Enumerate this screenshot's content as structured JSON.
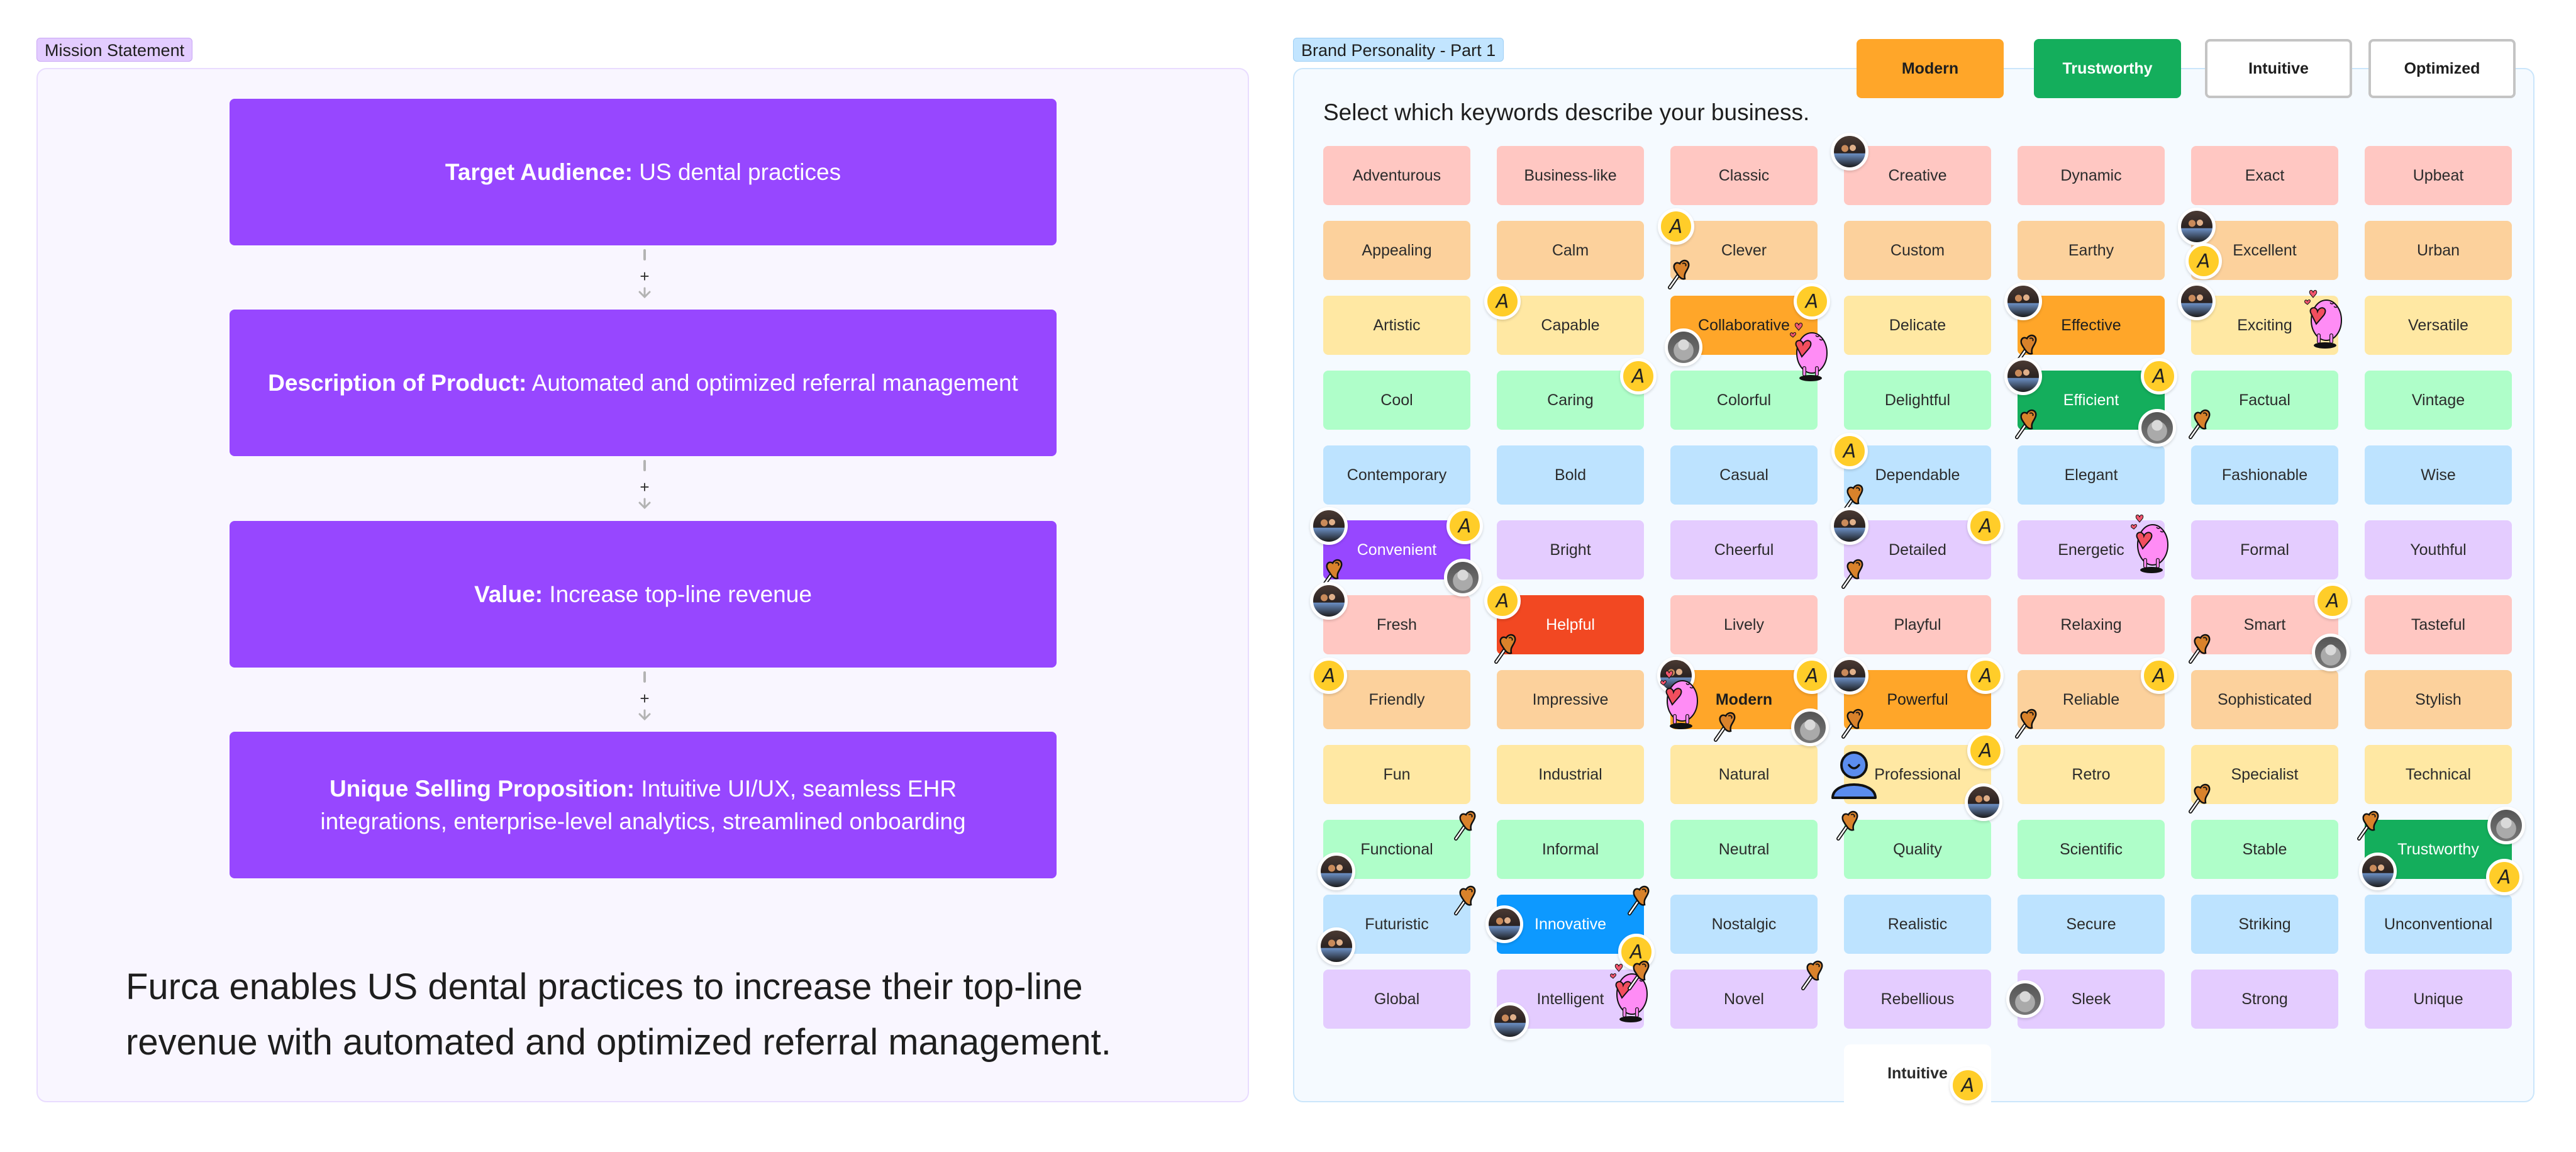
{
  "mission": {
    "label": "Mission Statement",
    "steps": [
      {
        "heading": "Target Audience:",
        "text": " US dental practices"
      },
      {
        "heading": "Description of Product:",
        "text": " Automated and optimized referral management"
      },
      {
        "heading": "Value:",
        "text": " Increase top-line revenue"
      },
      {
        "heading": "Unique Selling Proposition:",
        "text": " Intuitive UI/UX, seamless EHR integrations, enterprise-level analytics, streamlined onboarding"
      }
    ],
    "connector_symbol": "+",
    "statement": "Furca enables US dental practices to increase their top-line revenue with automated and optimized referral management."
  },
  "brand": {
    "label": "Brand Personality - Part 1",
    "prompt": "Select which keywords describe your business.",
    "chosen": [
      {
        "label": "Modern",
        "color": "#ffa629",
        "text_color": "#1e1e1e"
      },
      {
        "label": "Trustworthy",
        "color": "#14ae5c",
        "text_color": "#ffffff"
      },
      {
        "label": "Intuitive",
        "color": "#ffffff",
        "text_color": "#1e1e1e"
      },
      {
        "label": "Optimized",
        "color": "#ffffff",
        "text_color": "#1e1e1e"
      }
    ],
    "row_colors": [
      "#ffc7c2",
      "#fcd19c",
      "#ffe8a3",
      "#affec9",
      "#bde3ff",
      "#e4ccff"
    ],
    "rows": [
      [
        "Adventurous",
        "Business-like",
        "Classic",
        "Creative",
        "Dynamic",
        "Exact",
        "Upbeat"
      ],
      [
        "Appealing",
        "Calm",
        "Clever",
        "Custom",
        "Earthy",
        "Excellent",
        "Urban"
      ],
      [
        "Artistic",
        "Capable",
        "Collaborative",
        "Delicate",
        "Effective",
        "Exciting",
        "Versatile"
      ],
      [
        "Cool",
        "Caring",
        "Colorful",
        "Delightful",
        "Efficient",
        "Factual",
        "Vintage"
      ],
      [
        "Contemporary",
        "Bold",
        "Casual",
        "Dependable",
        "Elegant",
        "Fashionable",
        "Wise"
      ],
      [
        "Convenient",
        "Bright",
        "Cheerful",
        "Detailed",
        "Energetic",
        "Formal",
        "Youthful"
      ],
      [
        "Fresh",
        "Helpful",
        "Lively",
        "Playful",
        "Relaxing",
        "Smart",
        "Tasteful"
      ],
      [
        "Friendly",
        "Impressive",
        "Modern",
        "Powerful",
        "Reliable",
        "Sophisticated",
        "Stylish"
      ],
      [
        "Fun",
        "Industrial",
        "Natural",
        "Professional",
        "Retro",
        "Specialist",
        "Technical"
      ],
      [
        "Functional",
        "Informal",
        "Neutral",
        "Quality",
        "Scientific",
        "Stable",
        "Trustworthy"
      ],
      [
        "Futuristic",
        "Innovative",
        "Nostalgic",
        "Realistic",
        "Secure",
        "Striking",
        "Unconventional"
      ],
      [
        "Global",
        "Intelligent",
        "Novel",
        "Rebellious",
        "Sleek",
        "Strong",
        "Unique"
      ]
    ],
    "highlighted": {
      "Collaborative": "orange",
      "Effective": "orange",
      "Modern": "orange",
      "Powerful": "orange",
      "Efficient": "green",
      "Trustworthy": "green",
      "Convenient": "purple",
      "Helpful": "red",
      "Innovative": "blue"
    },
    "stickers": [
      {
        "type": "avatar-group",
        "tile": "Creative",
        "pos": "tl"
      },
      {
        "type": "badge-a",
        "tile": "Clever",
        "pos": "tl"
      },
      {
        "type": "pin",
        "tile": "Clever",
        "pos": "bl"
      },
      {
        "type": "badge-a",
        "tile": "Capable",
        "pos": "tl"
      },
      {
        "type": "badge-a",
        "tile": "Collaborative",
        "pos": "tr"
      },
      {
        "type": "monster",
        "tile": "Collaborative",
        "pos": "br"
      },
      {
        "type": "avatar-woman",
        "tile": "Collaborative",
        "pos": "bl"
      },
      {
        "type": "badge-a",
        "tile": "Caring",
        "pos": "tr"
      },
      {
        "type": "avatar-group",
        "tile": "Excellent",
        "pos": "tl"
      },
      {
        "type": "badge-a",
        "tile": "Excellent",
        "pos": "ml"
      },
      {
        "type": "avatar-group",
        "tile": "Effective",
        "pos": "tl"
      },
      {
        "type": "pin",
        "tile": "Effective",
        "pos": "bl"
      },
      {
        "type": "avatar-group",
        "tile": "Exciting",
        "pos": "tl"
      },
      {
        "type": "monster",
        "tile": "Exciting",
        "pos": "r"
      },
      {
        "type": "avatar-group",
        "tile": "Efficient",
        "pos": "tl"
      },
      {
        "type": "pin",
        "tile": "Efficient",
        "pos": "bl"
      },
      {
        "type": "badge-a",
        "tile": "Efficient",
        "pos": "tr"
      },
      {
        "type": "avatar-woman",
        "tile": "Efficient",
        "pos": "br"
      },
      {
        "type": "pin",
        "tile": "Factual",
        "pos": "bl"
      },
      {
        "type": "badge-a",
        "tile": "Dependable",
        "pos": "tl"
      },
      {
        "type": "pin",
        "tile": "Dependable",
        "pos": "bl"
      },
      {
        "type": "avatar-group",
        "tile": "Convenient",
        "pos": "tl"
      },
      {
        "type": "badge-a",
        "tile": "Convenient",
        "pos": "tr"
      },
      {
        "type": "pin",
        "tile": "Convenient",
        "pos": "bl"
      },
      {
        "type": "avatar-woman",
        "tile": "Convenient",
        "pos": "br"
      },
      {
        "type": "avatar-group",
        "tile": "Detailed",
        "pos": "tl"
      },
      {
        "type": "badge-a",
        "tile": "Detailed",
        "pos": "tr"
      },
      {
        "type": "pin",
        "tile": "Detailed",
        "pos": "bl"
      },
      {
        "type": "monster",
        "tile": "Energetic",
        "pos": "r"
      },
      {
        "type": "avatar-group",
        "tile": "Fresh",
        "pos": "tl"
      },
      {
        "type": "badge-a",
        "tile": "Helpful",
        "pos": "tl"
      },
      {
        "type": "pin",
        "tile": "Helpful",
        "pos": "bl"
      },
      {
        "type": "badge-a",
        "tile": "Smart",
        "pos": "tr"
      },
      {
        "type": "pin",
        "tile": "Smart",
        "pos": "bl"
      },
      {
        "type": "avatar-woman",
        "tile": "Smart",
        "pos": "br"
      },
      {
        "type": "badge-a",
        "tile": "Friendly",
        "pos": "tl"
      },
      {
        "type": "avatar-group",
        "tile": "Modern",
        "pos": "tl"
      },
      {
        "type": "badge-a",
        "tile": "Modern",
        "pos": "tr"
      },
      {
        "type": "monster",
        "tile": "Modern",
        "pos": "l"
      },
      {
        "type": "pin",
        "tile": "Modern",
        "pos": "bm"
      },
      {
        "type": "avatar-woman",
        "tile": "Modern",
        "pos": "br"
      },
      {
        "type": "avatar-group",
        "tile": "Powerful",
        "pos": "tl"
      },
      {
        "type": "badge-a",
        "tile": "Powerful",
        "pos": "tr"
      },
      {
        "type": "pin",
        "tile": "Powerful",
        "pos": "bl"
      },
      {
        "type": "badge-a",
        "tile": "Reliable",
        "pos": "tr"
      },
      {
        "type": "pin",
        "tile": "Reliable",
        "pos": "bl"
      },
      {
        "type": "person",
        "tile": "Professional",
        "pos": "l"
      },
      {
        "type": "badge-a",
        "tile": "Professional",
        "pos": "tr"
      },
      {
        "type": "avatar-group",
        "tile": "Professional",
        "pos": "br"
      },
      {
        "type": "pin",
        "tile": "Specialist",
        "pos": "bl"
      },
      {
        "type": "pin",
        "tile": "Functional",
        "pos": "tr"
      },
      {
        "type": "avatar-group",
        "tile": "Functional",
        "pos": "bl"
      },
      {
        "type": "pin",
        "tile": "Quality",
        "pos": "tl"
      },
      {
        "type": "pin",
        "tile": "Trustworthy",
        "pos": "tl"
      },
      {
        "type": "avatar-group",
        "tile": "Trustworthy",
        "pos": "bl"
      },
      {
        "type": "avatar-woman",
        "tile": "Trustworthy",
        "pos": "tr"
      },
      {
        "type": "badge-a",
        "tile": "Trustworthy",
        "pos": "br"
      },
      {
        "type": "pin",
        "tile": "Futuristic",
        "pos": "tr"
      },
      {
        "type": "avatar-group",
        "tile": "Futuristic",
        "pos": "bl"
      },
      {
        "type": "avatar-group",
        "tile": "Innovative",
        "pos": "l"
      },
      {
        "type": "pin",
        "tile": "Innovative",
        "pos": "tr"
      },
      {
        "type": "badge-a",
        "tile": "Innovative",
        "pos": "br"
      },
      {
        "type": "avatar-group",
        "tile": "Intelligent",
        "pos": "bl"
      },
      {
        "type": "monster",
        "tile": "Intelligent",
        "pos": "r"
      },
      {
        "type": "pin",
        "tile": "Intelligent",
        "pos": "tr"
      },
      {
        "type": "pin",
        "tile": "Novel",
        "pos": "tr"
      },
      {
        "type": "avatar-woman",
        "tile": "Sleek",
        "pos": "l"
      }
    ],
    "dragged_card": {
      "label": "Intuitive",
      "badge": "A"
    },
    "badge_letter": "A"
  }
}
